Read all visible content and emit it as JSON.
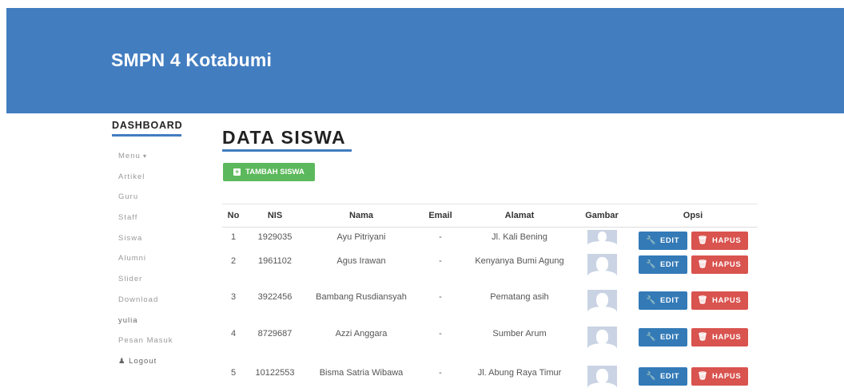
{
  "header": {
    "brand": "SMPN 4 Kotabumi",
    "color": "#427dc0"
  },
  "sidebar": {
    "title": "DASHBOARD",
    "items": [
      {
        "label": "Menu"
      },
      {
        "label": "Artikel"
      },
      {
        "label": "Guru"
      },
      {
        "label": "Staff"
      },
      {
        "label": "Siswa"
      },
      {
        "label": "Alumni"
      },
      {
        "label": "Slider"
      },
      {
        "label": "Download"
      },
      {
        "label": "yulia"
      },
      {
        "label": "Pesan Masuk"
      },
      {
        "label": "Logout",
        "icon": "user-icon"
      }
    ]
  },
  "main": {
    "title": "DATA SISWA",
    "add_button": {
      "label": "TAMBAH SISWA",
      "icon": "plus-square-icon",
      "color": "#5cb85c"
    }
  },
  "table": {
    "headers": [
      "No",
      "NIS",
      "Nama",
      "Email",
      "Alamat",
      "Gambar",
      "Opsi"
    ],
    "rows": [
      {
        "no": "1",
        "nis": "1929035",
        "nama": "Ayu Pitriyani",
        "email": "-",
        "alamat": "Jl. Kali Bening"
      },
      {
        "no": "2",
        "nis": "1961102",
        "nama": "Agus Irawan",
        "email": "-",
        "alamat": "Kenyanya Bumi Agung"
      },
      {
        "no": "3",
        "nis": "3922456",
        "nama": "Bambang Rusdiansyah",
        "email": "-",
        "alamat": "Pematang asih"
      },
      {
        "no": "4",
        "nis": "8729687",
        "nama": "Azzi Anggara",
        "email": "-",
        "alamat": "Sumber Arum"
      },
      {
        "no": "5",
        "nis": "10122553",
        "nama": "Bisma Satria Wibawa",
        "email": "-",
        "alamat": "Jl. Abung Raya Timur"
      }
    ],
    "edit_label": "EDIT",
    "delete_label": "HAPUS",
    "edit_icon": "wrench-icon",
    "delete_icon": "trash-icon",
    "edit_color": "#337ab7",
    "delete_color": "#d9534f"
  }
}
